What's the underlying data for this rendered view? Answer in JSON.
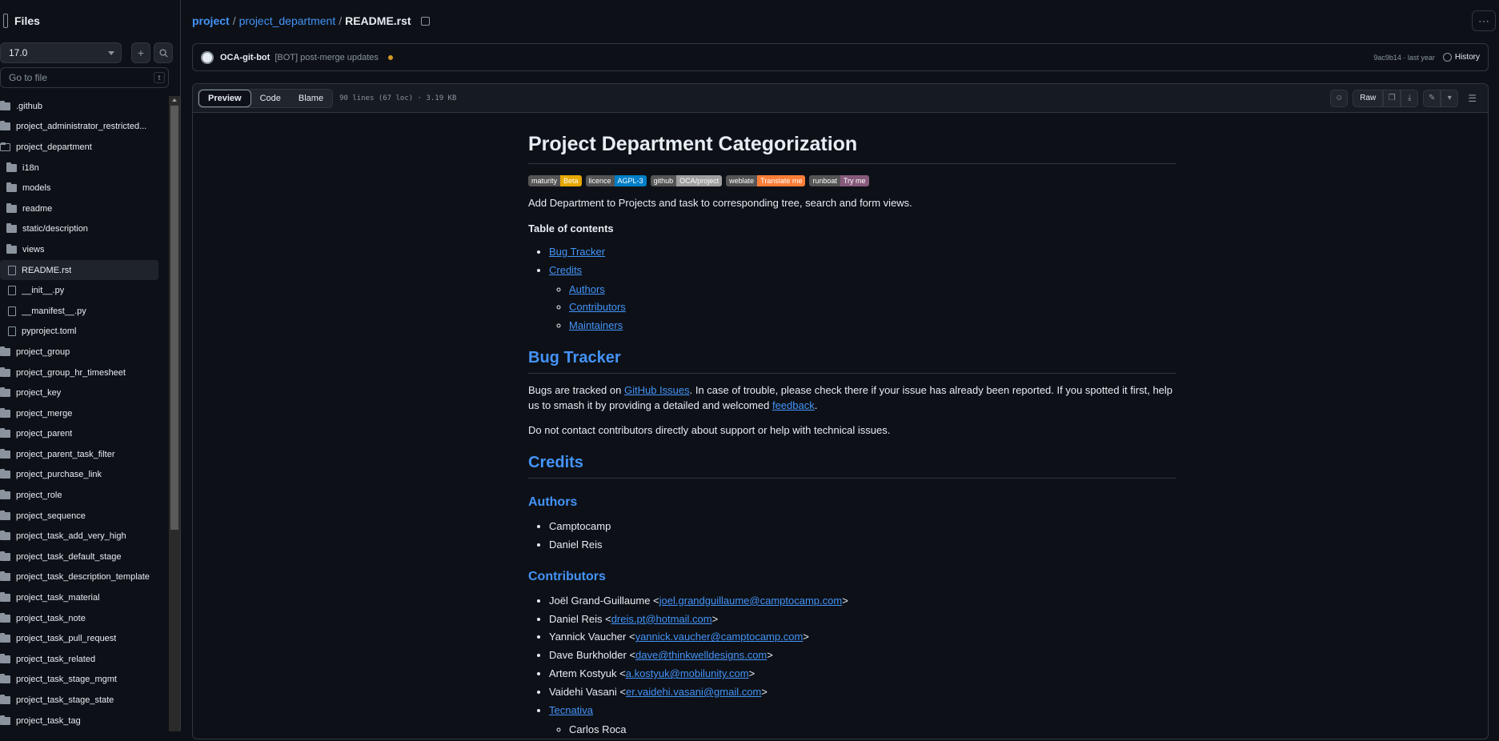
{
  "sidebar": {
    "title": "Files",
    "branch": "17.0",
    "goto_placeholder": "Go to file",
    "goto_kbd": "t",
    "items": [
      {
        "label": ".github",
        "type": "folder",
        "depth": 0
      },
      {
        "label": "project_administrator_restricted...",
        "type": "folder",
        "depth": 0
      },
      {
        "label": "project_department",
        "type": "folder-open",
        "depth": 0
      },
      {
        "label": "i18n",
        "type": "folder",
        "depth": 1
      },
      {
        "label": "models",
        "type": "folder",
        "depth": 1
      },
      {
        "label": "readme",
        "type": "folder",
        "depth": 1
      },
      {
        "label": "static/description",
        "type": "folder",
        "depth": 1
      },
      {
        "label": "views",
        "type": "folder",
        "depth": 1
      },
      {
        "label": "README.rst",
        "type": "file",
        "depth": 1,
        "selected": true
      },
      {
        "label": "__init__.py",
        "type": "file",
        "depth": 1
      },
      {
        "label": "__manifest__.py",
        "type": "file",
        "depth": 1
      },
      {
        "label": "pyproject.toml",
        "type": "file",
        "depth": 1
      },
      {
        "label": "project_group",
        "type": "folder",
        "depth": 0
      },
      {
        "label": "project_group_hr_timesheet",
        "type": "folder",
        "depth": 0
      },
      {
        "label": "project_key",
        "type": "folder",
        "depth": 0
      },
      {
        "label": "project_merge",
        "type": "folder",
        "depth": 0
      },
      {
        "label": "project_parent",
        "type": "folder",
        "depth": 0
      },
      {
        "label": "project_parent_task_filter",
        "type": "folder",
        "depth": 0
      },
      {
        "label": "project_purchase_link",
        "type": "folder",
        "depth": 0
      },
      {
        "label": "project_role",
        "type": "folder",
        "depth": 0
      },
      {
        "label": "project_sequence",
        "type": "folder",
        "depth": 0
      },
      {
        "label": "project_task_add_very_high",
        "type": "folder",
        "depth": 0
      },
      {
        "label": "project_task_default_stage",
        "type": "folder",
        "depth": 0
      },
      {
        "label": "project_task_description_template",
        "type": "folder",
        "depth": 0
      },
      {
        "label": "project_task_material",
        "type": "folder",
        "depth": 0
      },
      {
        "label": "project_task_note",
        "type": "folder",
        "depth": 0
      },
      {
        "label": "project_task_pull_request",
        "type": "folder",
        "depth": 0
      },
      {
        "label": "project_task_related",
        "type": "folder",
        "depth": 0
      },
      {
        "label": "project_task_stage_mgmt",
        "type": "folder",
        "depth": 0
      },
      {
        "label": "project_task_stage_state",
        "type": "folder",
        "depth": 0
      },
      {
        "label": "project_task_tag",
        "type": "folder",
        "depth": 0
      }
    ]
  },
  "breadcrumb": {
    "repo": "project",
    "folder": "project_department",
    "file": "README.rst",
    "sep": "/"
  },
  "commit": {
    "author": "OCA-git-bot",
    "message": "[BOT] post-merge updates",
    "hash_time": "9ac9b14 · last year",
    "history_label": "History",
    "status_color": "#d29922"
  },
  "file_header": {
    "tabs": [
      "Preview",
      "Code",
      "Blame"
    ],
    "active_tab": "Preview",
    "meta": "90 lines (67 loc) · 3.19 KB",
    "raw_label": "Raw"
  },
  "readme": {
    "title": "Project Department Categorization",
    "badges": [
      {
        "left": "maturity",
        "right": "Beta",
        "color": "#e7a700"
      },
      {
        "left": "licence",
        "right": "AGPL-3",
        "color": "#007ec6"
      },
      {
        "left": "github",
        "right": "OCA/project",
        "color": "#9f9f9f"
      },
      {
        "left": "weblate",
        "right": "Translate me",
        "color": "#fe7d37"
      },
      {
        "left": "runboat",
        "right": "Try me",
        "color": "#875a7b"
      }
    ],
    "intro": "Add Department to Projects and task to corresponding tree, search and form views.",
    "toc_title": "Table of contents",
    "toc": {
      "bug_tracker": "Bug Tracker",
      "credits": "Credits",
      "authors": "Authors",
      "contributors": "Contributors",
      "maintainers": "Maintainers"
    },
    "bug_tracker": {
      "heading": "Bug Tracker",
      "p1_a": "Bugs are tracked on ",
      "p1_link": "GitHub Issues",
      "p1_b": ". In case of trouble, please check there if your issue has already been reported. If you spotted it first, help us to smash it by providing a detailed and welcomed ",
      "p1_link2": "feedback",
      "p1_c": ".",
      "p2": "Do not contact contributors directly about support or help with technical issues."
    },
    "credits_heading": "Credits",
    "authors_heading": "Authors",
    "authors": [
      "Camptocamp",
      "Daniel Reis"
    ],
    "contributors_heading": "Contributors",
    "contributors": [
      {
        "name": "Joël Grand-Guillaume <",
        "email": "joel.grandguillaume@camptocamp.com",
        "end": ">"
      },
      {
        "name": "Daniel Reis <",
        "email": "dreis.pt@hotmail.com",
        "end": ">"
      },
      {
        "name": "Yannick Vaucher <",
        "email": "yannick.vaucher@camptocamp.com",
        "end": ">"
      },
      {
        "name": "Dave Burkholder <",
        "email": "dave@thinkwelldesigns.com",
        "end": ">"
      },
      {
        "name": "Artem Kostyuk <",
        "email": "a.kostyuk@mobilunity.com",
        "end": ">"
      },
      {
        "name": "Vaidehi Vasani <",
        "email": "er.vaidehi.vasani@gmail.com",
        "end": ">"
      }
    ],
    "tecnativa": "Tecnativa",
    "tecnativa_sub": [
      "Carlos Roca"
    ]
  }
}
